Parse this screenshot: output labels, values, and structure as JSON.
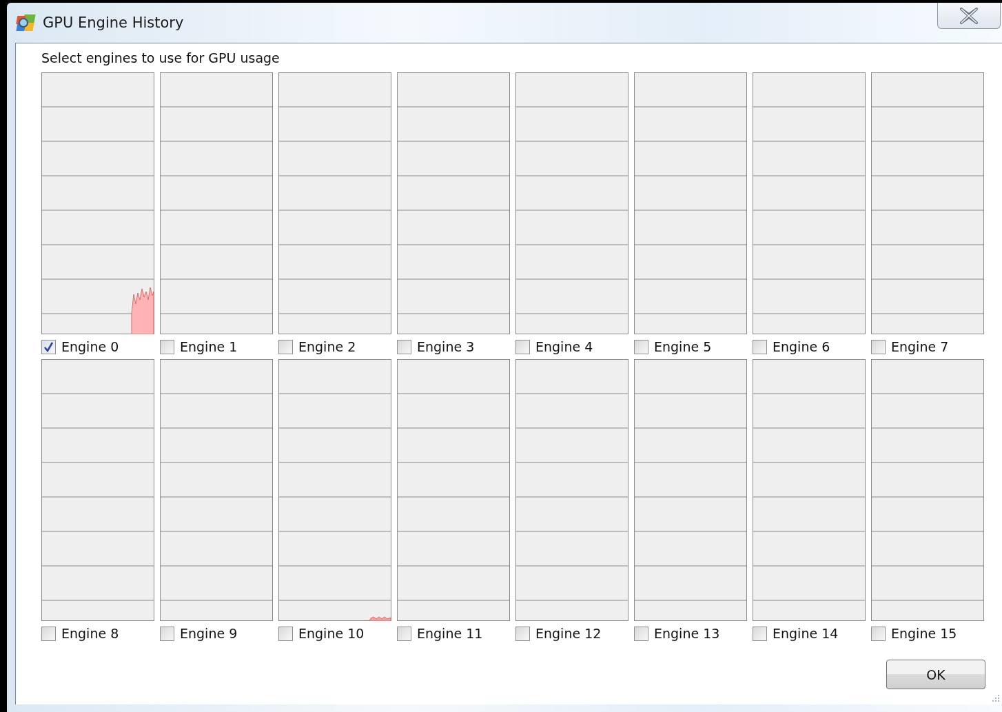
{
  "window": {
    "title": "GPU Engine History"
  },
  "instruction": "Select engines to use for GPU usage",
  "engines": [
    {
      "label": "Engine 0",
      "checked": true,
      "kind": "burst"
    },
    {
      "label": "Engine 1",
      "checked": false,
      "kind": "idle"
    },
    {
      "label": "Engine 2",
      "checked": false,
      "kind": "idle"
    },
    {
      "label": "Engine 3",
      "checked": false,
      "kind": "idle"
    },
    {
      "label": "Engine 4",
      "checked": false,
      "kind": "idle"
    },
    {
      "label": "Engine 5",
      "checked": false,
      "kind": "idle"
    },
    {
      "label": "Engine 6",
      "checked": false,
      "kind": "idle"
    },
    {
      "label": "Engine 7",
      "checked": false,
      "kind": "idle"
    },
    {
      "label": "Engine 8",
      "checked": false,
      "kind": "idle"
    },
    {
      "label": "Engine 9",
      "checked": false,
      "kind": "idle"
    },
    {
      "label": "Engine 10",
      "checked": false,
      "kind": "trace"
    },
    {
      "label": "Engine 11",
      "checked": false,
      "kind": "idle"
    },
    {
      "label": "Engine 12",
      "checked": false,
      "kind": "idle"
    },
    {
      "label": "Engine 13",
      "checked": false,
      "kind": "idle"
    },
    {
      "label": "Engine 14",
      "checked": false,
      "kind": "idle"
    },
    {
      "label": "Engine 15",
      "checked": false,
      "kind": "idle"
    }
  ],
  "buttons": [
    "OK"
  ]
}
